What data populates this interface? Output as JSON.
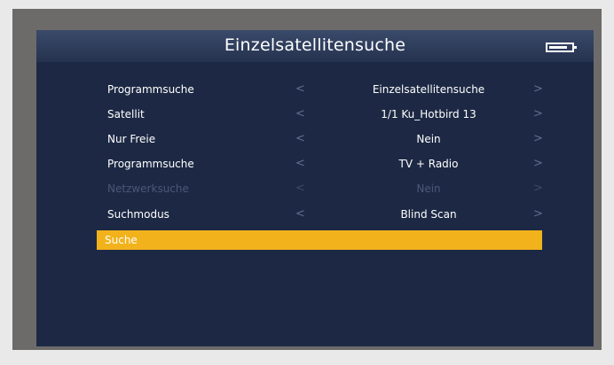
{
  "header": {
    "title": "Einzelsatellitensuche",
    "battery_icon": "battery-icon"
  },
  "menu": {
    "rows": [
      {
        "label": "Programmsuche",
        "value": "Einzelsatellitensuche"
      },
      {
        "label": "Satellit",
        "value": "1/1 Ku_Hotbird 13"
      },
      {
        "label": "Nur Freie",
        "value": "Nein"
      },
      {
        "label": "Programmsuche",
        "value": "TV + Radio"
      },
      {
        "label": "Netzwerksuche",
        "value": "Nein",
        "disabled": true
      },
      {
        "label": "Suchmodus",
        "value": "Blind Scan"
      }
    ],
    "arrow_left": "<",
    "arrow_right": ">",
    "search_label": "Suche"
  },
  "colors": {
    "background": "#1d2944",
    "highlight": "#f1b21c",
    "bezel": "#6d6b6a"
  }
}
